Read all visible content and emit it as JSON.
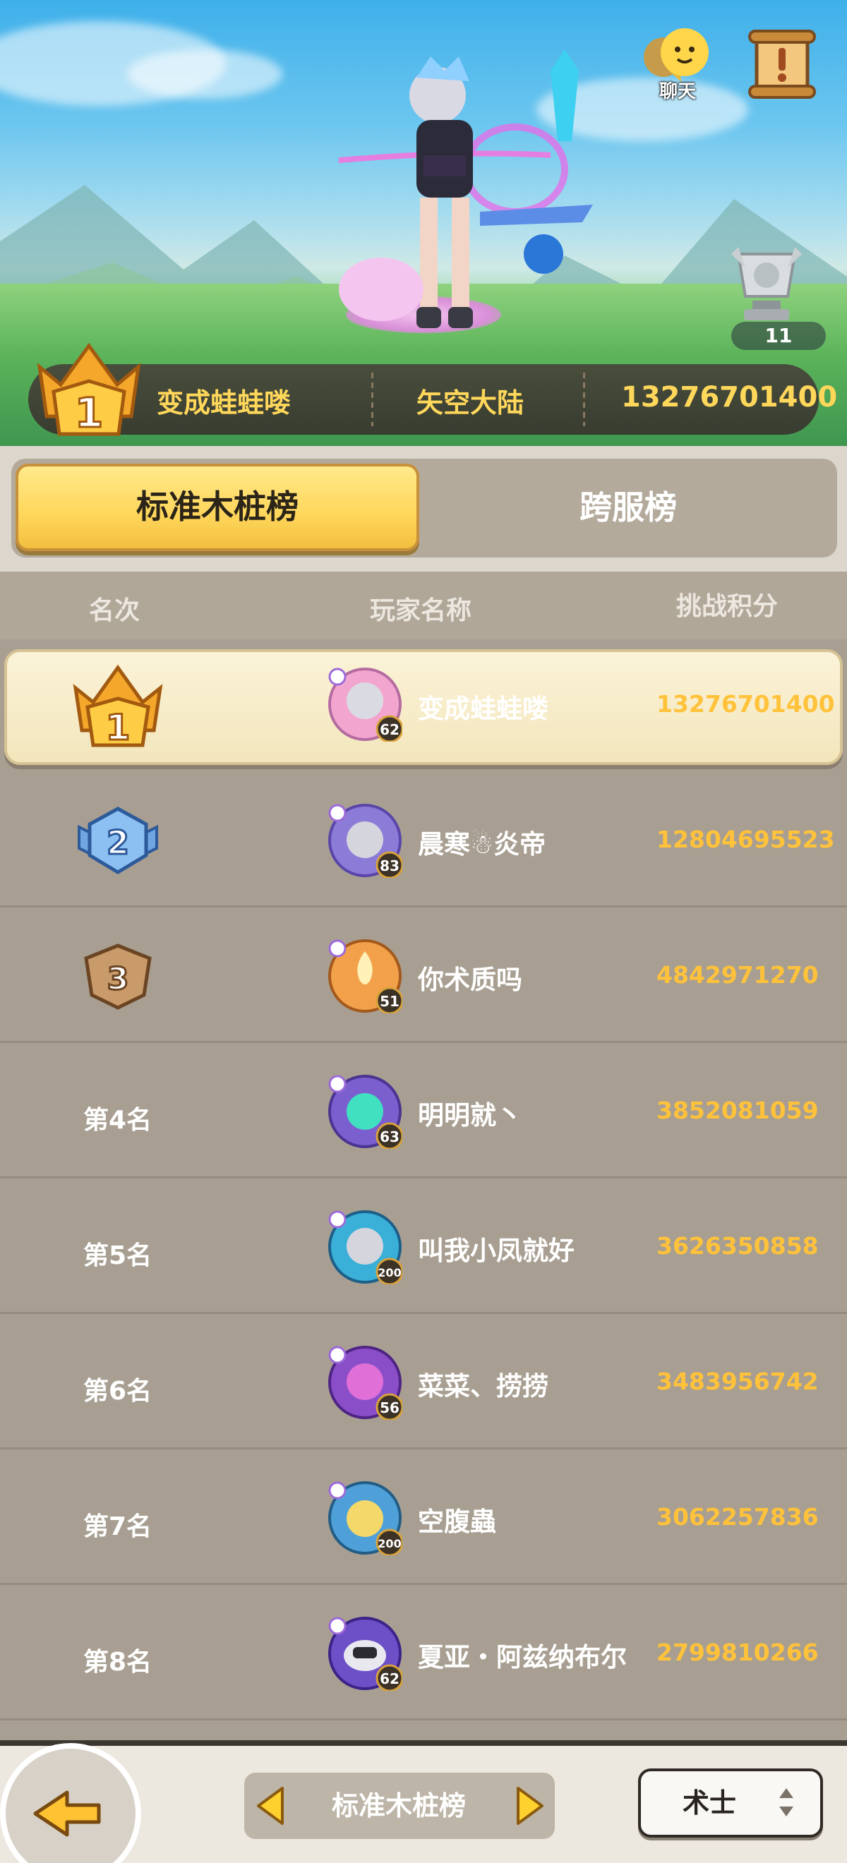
{
  "hero": {
    "chat_label": "聊天",
    "trophy_count": "11",
    "top_player": {
      "name": "变成蛙蛙喽",
      "server": "矢空大陆",
      "score": "13276701400"
    }
  },
  "tabs": [
    {
      "label": "标准木桩榜",
      "active": true
    },
    {
      "label": "跨服榜",
      "active": false
    }
  ],
  "table": {
    "headers": {
      "rank": "名次",
      "player": "玩家名称",
      "score": "挑战积分"
    },
    "rows": [
      {
        "rank": "1",
        "rank_label": "",
        "name": "变成蛙蛙喽",
        "score": "13276701400",
        "level": "62",
        "avatar_color": "#f2a6cf"
      },
      {
        "rank": "2",
        "rank_label": "",
        "name": "晨寒☃炎帝",
        "score": "12804695523",
        "level": "83",
        "avatar_color": "#8d7bd8"
      },
      {
        "rank": "3",
        "rank_label": "",
        "name": "你术质吗",
        "score": "4842971270",
        "level": "51",
        "avatar_color": "#f2a14a"
      },
      {
        "rank": "4",
        "rank_label": "第4名",
        "name": "明明就丶",
        "score": "3852081059",
        "level": "63",
        "avatar_color": "#7b5fcf"
      },
      {
        "rank": "5",
        "rank_label": "第5名",
        "name": "叫我小凤就好",
        "score": "3626350858",
        "level": "200",
        "avatar_color": "#3ab0d8"
      },
      {
        "rank": "6",
        "rank_label": "第6名",
        "name": "菜菜、捞捞",
        "score": "3483956742",
        "level": "56",
        "avatar_color": "#8a4fc8"
      },
      {
        "rank": "7",
        "rank_label": "第7名",
        "name": "空腹蟲",
        "score": "3062257836",
        "level": "200",
        "avatar_color": "#4fa0d8"
      },
      {
        "rank": "8",
        "rank_label": "第8名",
        "name": "夏亚・阿兹纳布尔",
        "score": "2799810266",
        "level": "62",
        "avatar_color": "#6d4fc8"
      }
    ]
  },
  "bottom": {
    "board_selector": "标准木桩榜",
    "class_selector": "术士"
  },
  "colors": {
    "gold": "#ffc23a",
    "tab_active": "#ffd65a",
    "row_bg": "#a89f92"
  }
}
